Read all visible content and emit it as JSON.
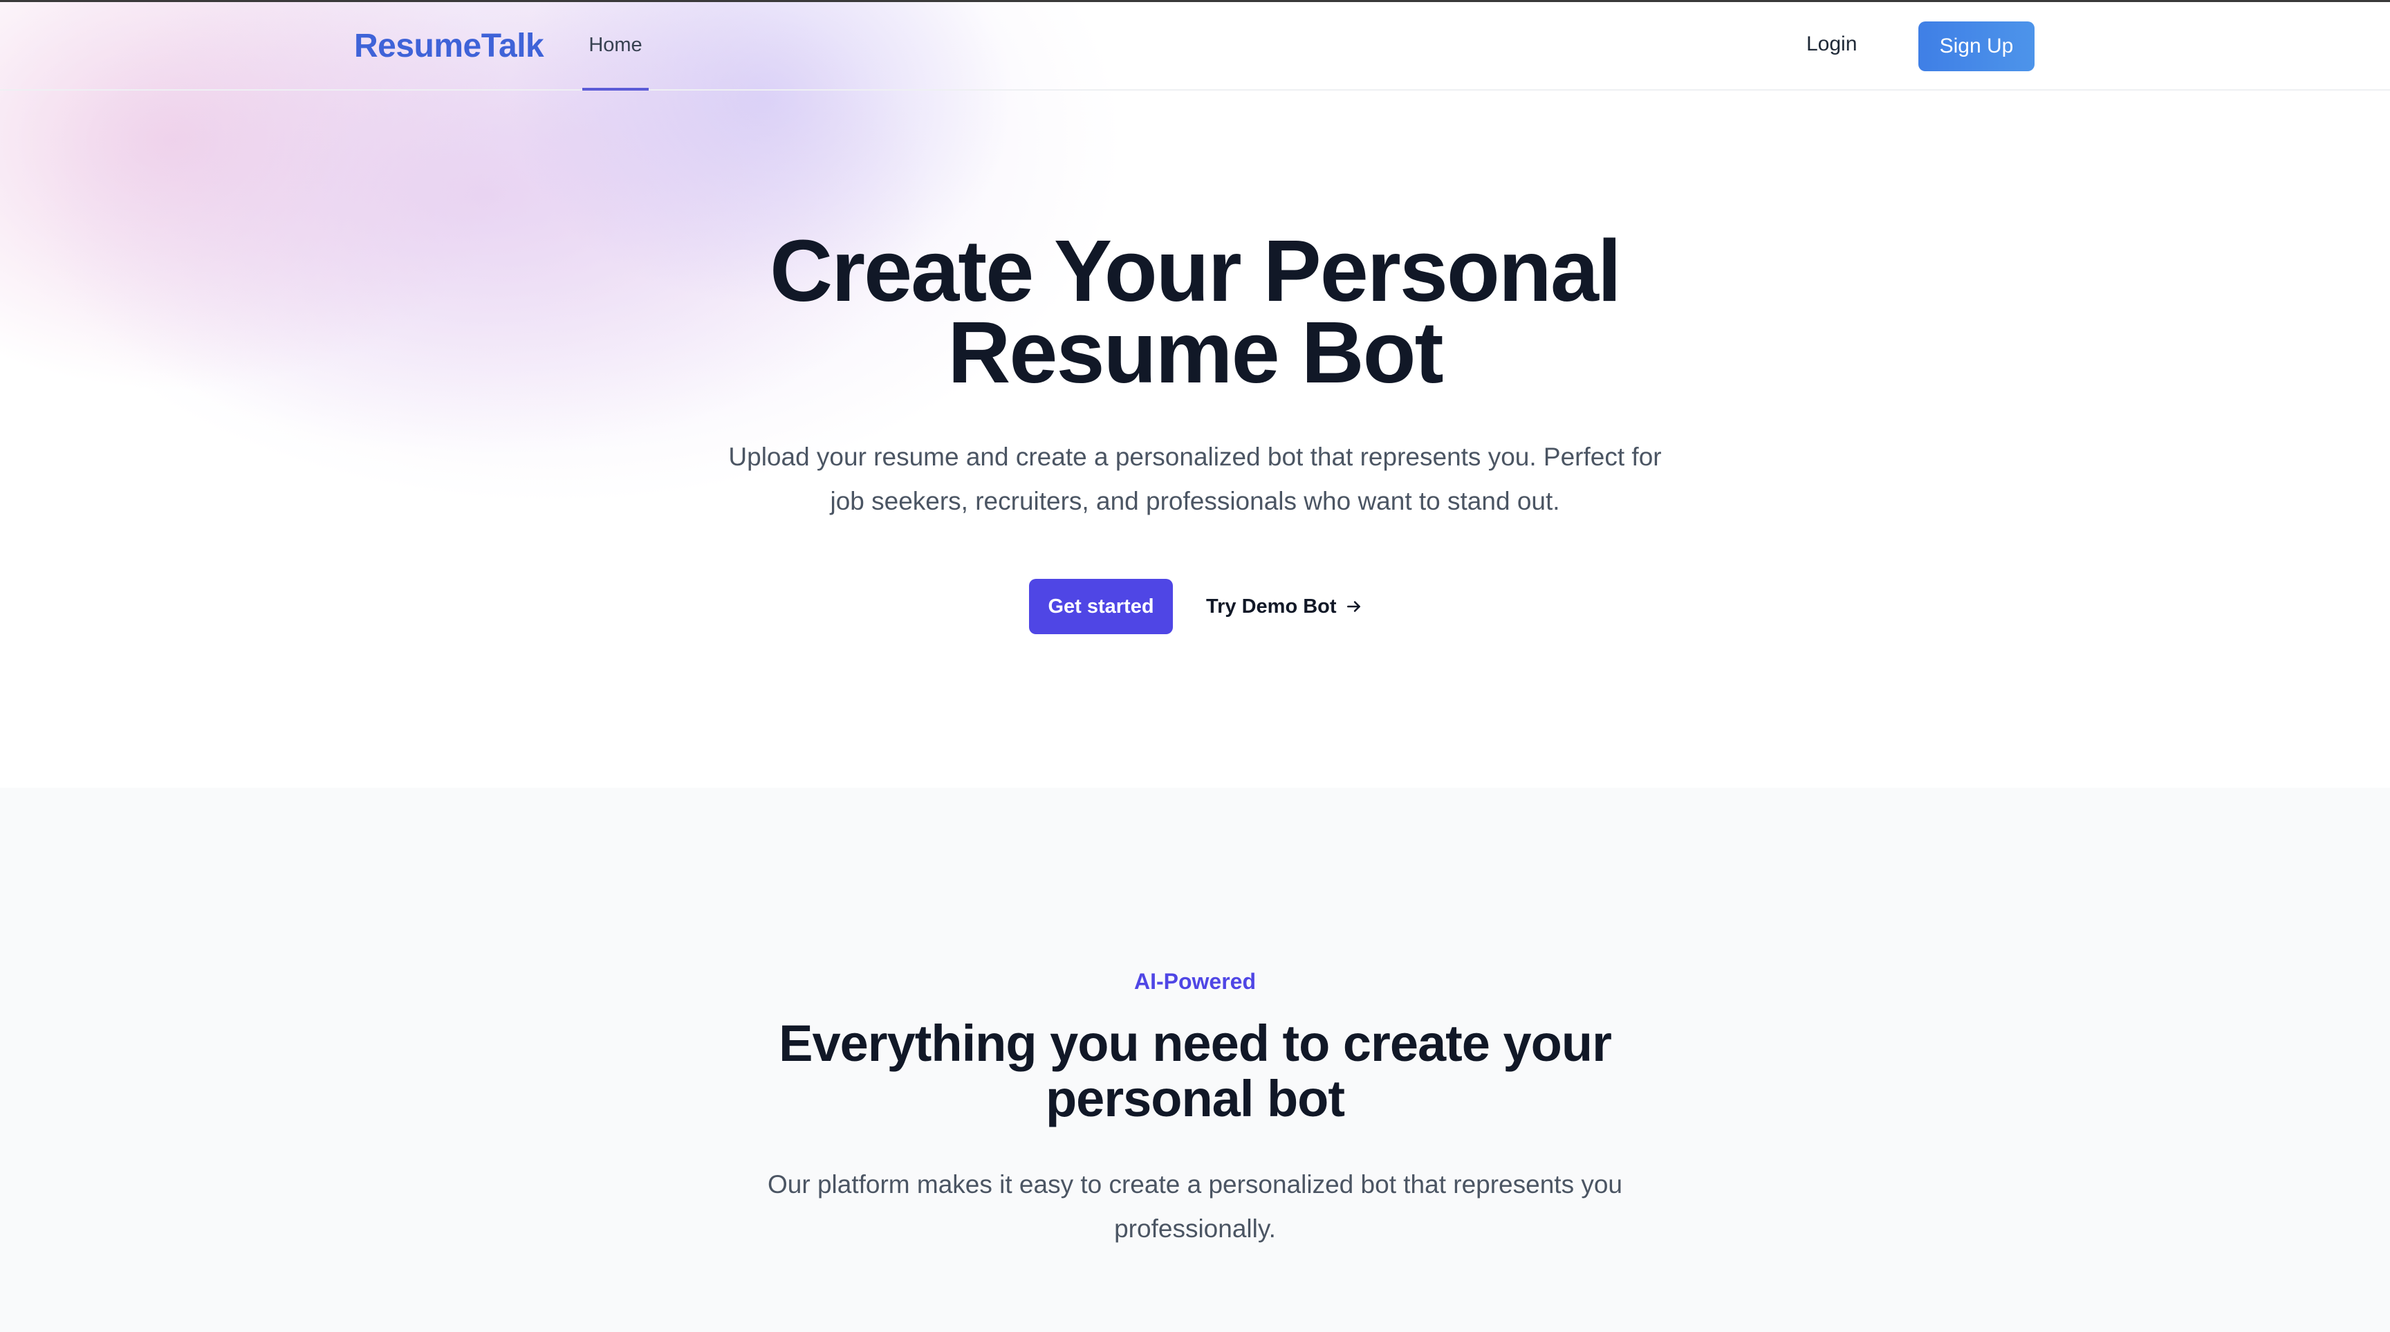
{
  "nav": {
    "logo": "ResumeTalk",
    "links": [
      {
        "label": "Home",
        "active": true
      }
    ],
    "login_label": "Login",
    "signup_label": "Sign Up"
  },
  "hero": {
    "title": "Create Your Personal Resume Bot",
    "subtitle": "Upload your resume and create a personalized bot that represents you. Perfect for job seekers, recruiters, and professionals who want to stand out.",
    "primary_cta": "Get started",
    "secondary_cta": "Try Demo Bot",
    "secondary_cta_icon": "arrow-right-icon"
  },
  "features": {
    "eyebrow": "AI-Powered",
    "title": "Everything you need to create your personal bot",
    "subtitle": "Our platform makes it easy to create a personalized bot that represents you professionally."
  },
  "colors": {
    "brand": "#3f63d8",
    "primary": "#4f46e5",
    "signup": "#4a8ee8",
    "heading": "#111827",
    "body": "#4b5563",
    "section_bg": "#f9fafb"
  }
}
